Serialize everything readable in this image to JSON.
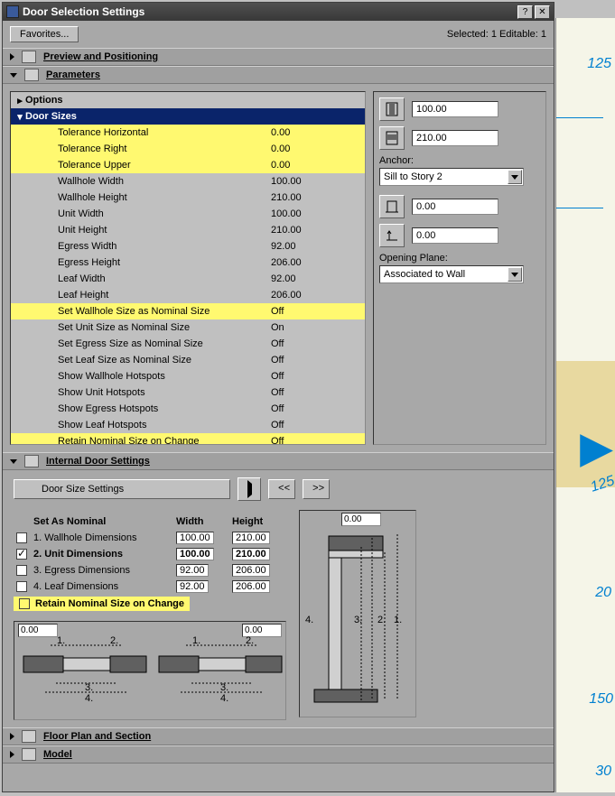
{
  "title": "Door Selection Settings",
  "favorites_label": "Favorites...",
  "status": "Selected: 1 Editable: 1",
  "sections": {
    "preview": "Preview and Positioning",
    "parameters": "Parameters",
    "internal": "Internal Door Settings",
    "floorplan": "Floor Plan and Section",
    "model": "Model"
  },
  "tree": {
    "options": "Options",
    "doorsizes": "Door Sizes",
    "rows": [
      {
        "name": "Tolerance Horizontal",
        "val": "0.00",
        "hl": true
      },
      {
        "name": "Tolerance Right",
        "val": "0.00",
        "hl": true
      },
      {
        "name": "Tolerance Upper",
        "val": "0.00",
        "hl": true
      },
      {
        "name": "Wallhole Width",
        "val": "100.00",
        "hl": false
      },
      {
        "name": "Wallhole Height",
        "val": "210.00",
        "hl": false
      },
      {
        "name": "Unit Width",
        "val": "100.00",
        "hl": false
      },
      {
        "name": "Unit Height",
        "val": "210.00",
        "hl": false
      },
      {
        "name": "Egress Width",
        "val": "92.00",
        "hl": false
      },
      {
        "name": "Egress Height",
        "val": "206.00",
        "hl": false
      },
      {
        "name": "Leaf Width",
        "val": "92.00",
        "hl": false
      },
      {
        "name": "Leaf Height",
        "val": "206.00",
        "hl": false
      },
      {
        "name": "Set Wallhole Size as Nominal Size",
        "val": "Off",
        "hl": true
      },
      {
        "name": "Set Unit Size as Nominal Size",
        "val": "On",
        "hl": false
      },
      {
        "name": "Set Egress Size as Nominal Size",
        "val": "Off",
        "hl": false
      },
      {
        "name": "Set Leaf Size as Nominal Size",
        "val": "Off",
        "hl": false
      },
      {
        "name": "Show Wallhole Hotspots",
        "val": "Off",
        "hl": false
      },
      {
        "name": "Show Unit Hotspots",
        "val": "Off",
        "hl": false
      },
      {
        "name": "Show Egress Hotspots",
        "val": "Off",
        "hl": false
      },
      {
        "name": "Show Leaf Hotspots",
        "val": "Off",
        "hl": false
      },
      {
        "name": "Retain Nominal Size on Change",
        "val": "Off",
        "hl": true
      }
    ]
  },
  "right": {
    "width_val": "100.00",
    "height_val": "210.00",
    "anchor_label": "Anchor:",
    "anchor_value": "Sill to Story 2",
    "offset1": "0.00",
    "offset2": "0.00",
    "plane_label": "Opening Plane:",
    "plane_value": "Associated to Wall"
  },
  "ids": {
    "door_size_settings": "Door Size Settings",
    "prev": "<<",
    "next": ">>",
    "set_as_nominal": "Set As Nominal",
    "col_width": "Width",
    "col_height": "Height",
    "rows": [
      {
        "label": "1. Wallhole Dimensions",
        "w": "100.00",
        "h": "210.00",
        "checked": false,
        "bold": false
      },
      {
        "label": "2. Unit Dimensions",
        "w": "100.00",
        "h": "210.00",
        "checked": true,
        "bold": true
      },
      {
        "label": "3. Egress Dimensions",
        "w": "92.00",
        "h": "206.00",
        "checked": false,
        "bold": false
      },
      {
        "label": "4. Leaf Dimensions",
        "w": "92.00",
        "h": "206.00",
        "checked": false,
        "bold": false
      }
    ],
    "retain": "Retain Nominal Size on Change",
    "diag_left_a": "0.00",
    "diag_left_b": "0.00",
    "diag_right_top": "0.00"
  },
  "cad": {
    "v125": "125",
    "v20": "20",
    "v150": "150",
    "v30": "30"
  }
}
